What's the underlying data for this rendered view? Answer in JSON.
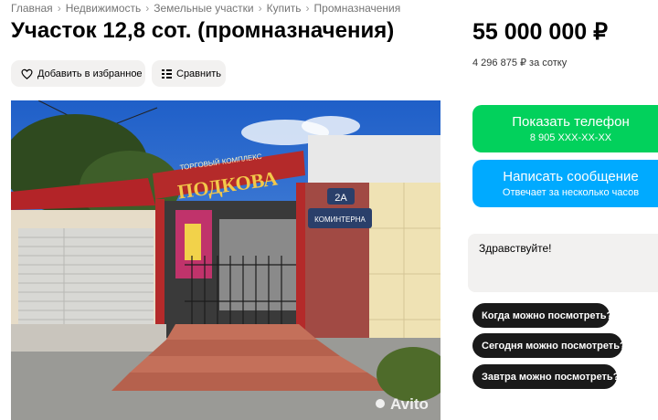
{
  "breadcrumb": [
    "Главная",
    "Недвижимость",
    "Земельные участки",
    "Купить",
    "Промназначения"
  ],
  "title": "Участок 12,8 сот. (промназначения)",
  "price": "55 000 000 ₽",
  "price_per_unit": "4 296 875 ₽ за сотку",
  "actions": {
    "favorite_label": "Добавить в избранное",
    "compare_label": "Сравнить"
  },
  "photo": {
    "sign_top": "ТОРГОВЫЙ КОМПЛЕКС",
    "sign_main": "ПОДКОВА",
    "house_number": "2А",
    "street_plate": "КОМИНТЕРНА",
    "watermark": "Avito"
  },
  "contact": {
    "call_label": "Показать телефон",
    "call_sub": "8 905 ХХХ-ХХ-ХХ",
    "message_label": "Написать сообщение",
    "message_sub": "Отвечает за несколько часов"
  },
  "message_box": {
    "text": "Здравствуйте!"
  },
  "quick_replies": [
    "Когда можно посмотреть?",
    "Сегодня можно посмотреть?",
    "Завтра можно посмотреть?"
  ],
  "colors": {
    "call": "#02d15c",
    "message": "#00aaff",
    "chip": "#1a1a1a"
  }
}
